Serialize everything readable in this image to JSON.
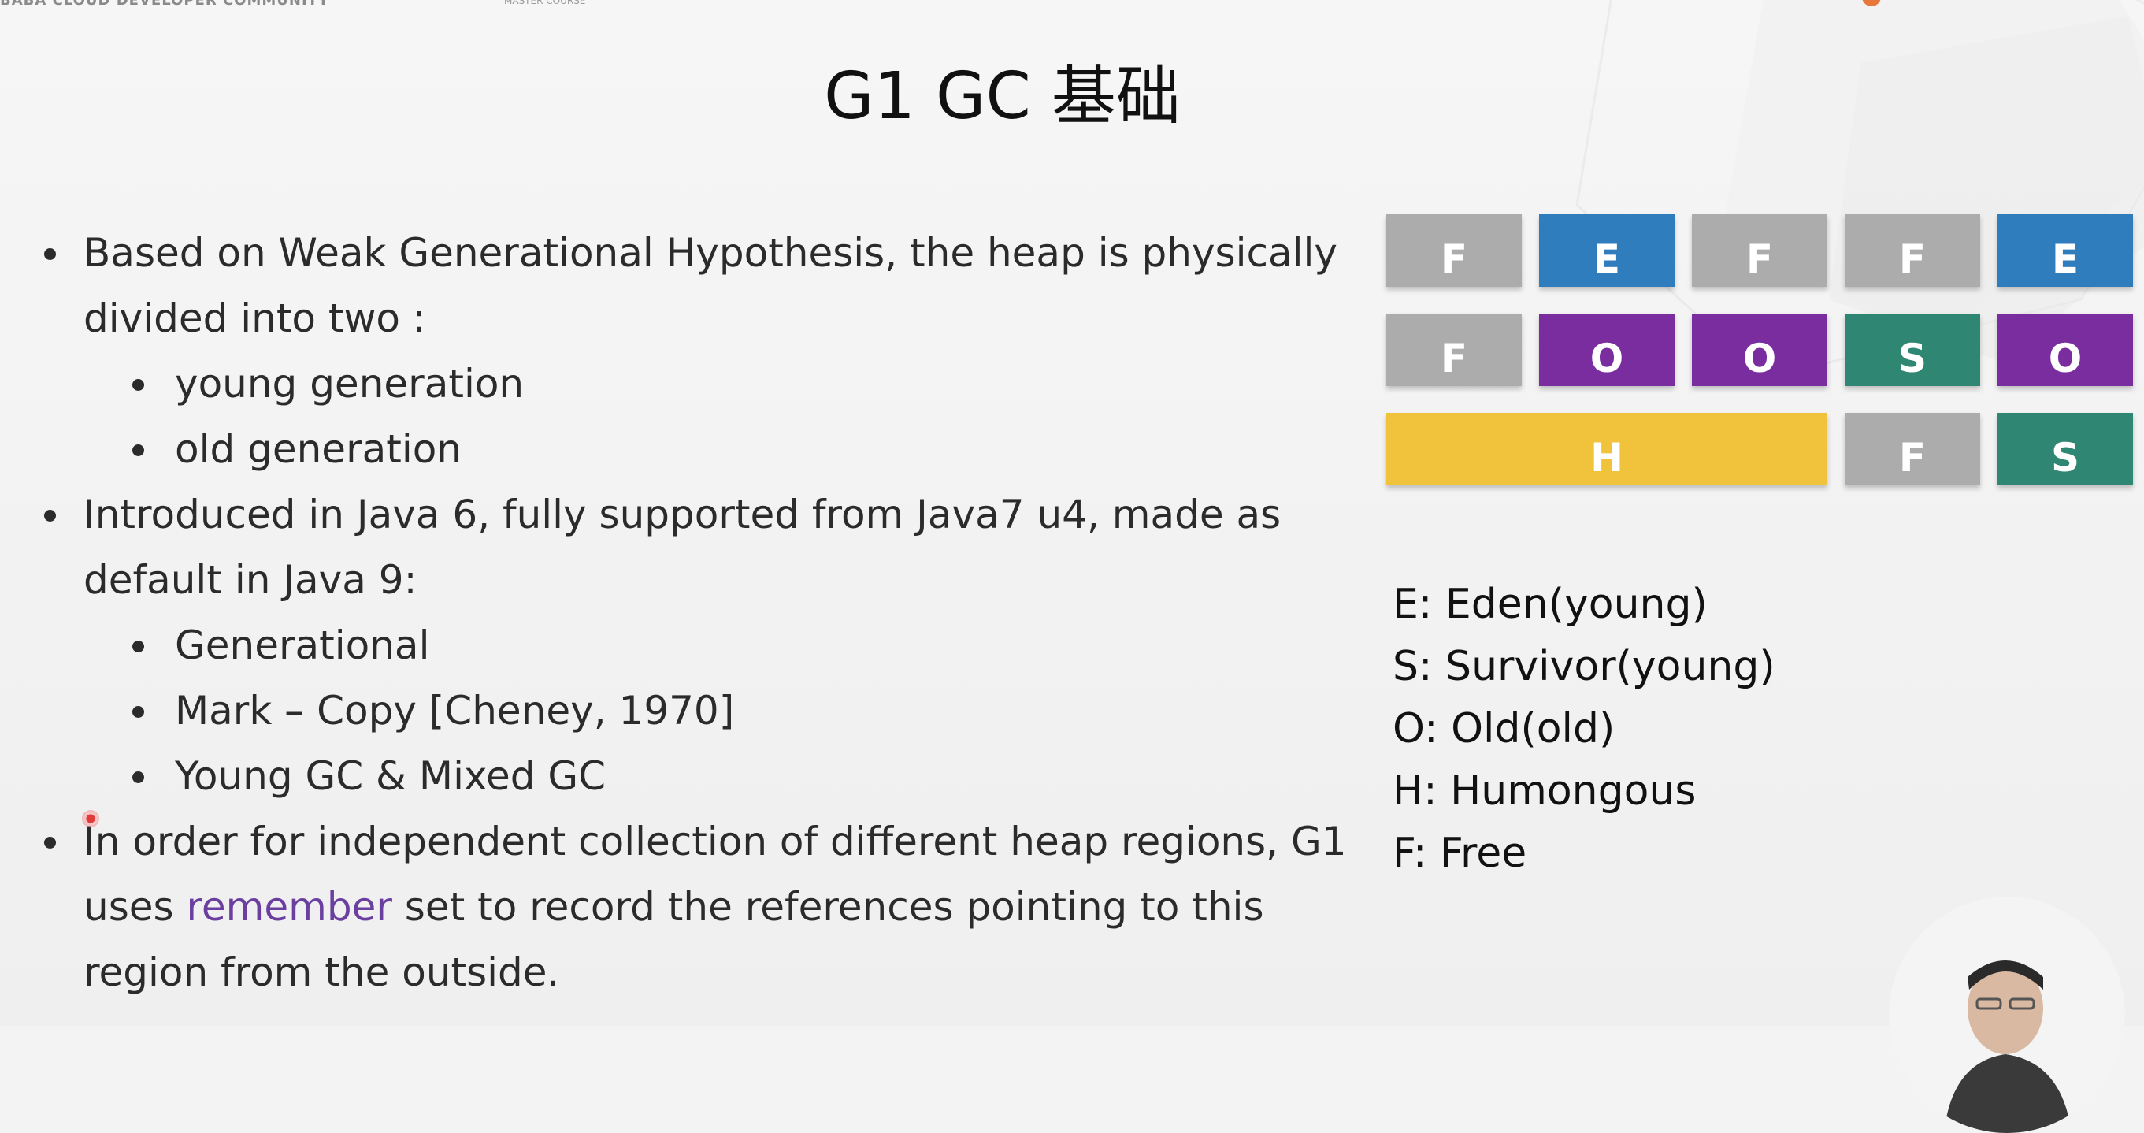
{
  "header": {
    "org_text": "BABA CLOUD DEVELOPER COMMUNITY",
    "course_text": "MASTER COURSE"
  },
  "slide": {
    "title": "G1 GC 基础",
    "bullets": [
      {
        "text": " Based on Weak Generational Hypothesis,  the heap is physically",
        "text_cont": "divided into two :",
        "children": [
          "young generation",
          "old generation"
        ]
      },
      {
        "text": "Introduced in Java 6, fully supported from Java7 u4, made as",
        "text_cont": "default in Java 9:",
        "children": [
          "Generational",
          "Mark – Copy [Cheney, 1970]",
          "Young GC & Mixed GC"
        ]
      },
      {
        "text": "In order for independent collection of different heap regions,  G1",
        "line2_before": "uses ",
        "line2_highlight": "remember",
        "line2_after": " set to record the references pointing to this",
        "line3": "region from the outside."
      }
    ]
  },
  "heap_grid": {
    "colors": {
      "F": "#acacac",
      "E": "#2f7dbd",
      "O": "#7a2d9e",
      "S": "#2f8673",
      "H": "#f1c33c"
    },
    "rows": [
      [
        "F",
        "E",
        "F",
        "F",
        "E"
      ],
      [
        "F",
        "O",
        "O",
        "S",
        "O"
      ],
      [
        "H",
        "F",
        "S"
      ]
    ]
  },
  "legend": [
    "E: Eden(young)",
    "S: Survivor(young)",
    "O: Old(old)",
    "H: Humongous",
    "F: Free"
  ]
}
